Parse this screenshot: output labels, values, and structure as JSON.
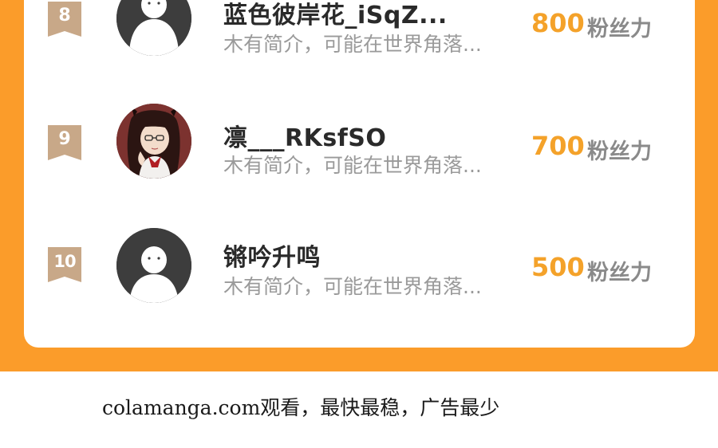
{
  "ranking": {
    "rows": [
      {
        "rank": "8",
        "name": "蓝色彼岸花_iSqZ...",
        "bio": "木有简介，可能在世界角落...",
        "score": "800",
        "unit": "粉丝力",
        "avatar": "default-avatar"
      },
      {
        "rank": "9",
        "name": "凛___RKsfSO",
        "bio": "木有简介，可能在世界角落...",
        "score": "700",
        "unit": "粉丝力",
        "avatar": "anime-girl-avatar"
      },
      {
        "rank": "10",
        "name": "锵吟升鸣",
        "bio": "木有简介，可能在世界角落...",
        "score": "500",
        "unit": "粉丝力",
        "avatar": "default-avatar"
      }
    ]
  },
  "footer": {
    "watermark": "colamanga.com观看，最快最稳，广告最少"
  },
  "colors": {
    "background_orange": "#fb9c2a",
    "score_orange": "#f4a22a",
    "rank_badge": "#c8a888"
  }
}
